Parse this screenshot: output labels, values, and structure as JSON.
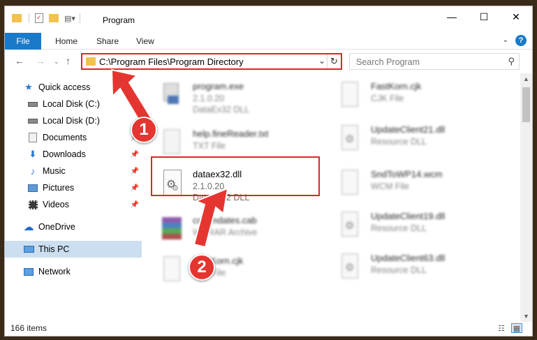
{
  "window": {
    "title": "Program",
    "controls": {
      "minimize": "—",
      "maximize": "☐",
      "close": "✕"
    }
  },
  "ribbon": {
    "file": "File",
    "tabs": [
      "Home",
      "Share",
      "View"
    ],
    "help": "?"
  },
  "nav": {
    "address": "C:\\Program Files\\Program Directory",
    "search_placeholder": "Search Program"
  },
  "sidebar": {
    "items": [
      {
        "label": "Quick access",
        "icon": "star-icon",
        "pinned": false
      },
      {
        "label": "Local Disk (C:)",
        "icon": "drive-icon",
        "pinned": false
      },
      {
        "label": "Local Disk (D:)",
        "icon": "drive-icon",
        "pinned": false
      },
      {
        "label": "Documents",
        "icon": "documents-icon",
        "pinned": true
      },
      {
        "label": "Downloads",
        "icon": "downloads-icon",
        "pinned": true
      },
      {
        "label": "Music",
        "icon": "music-icon",
        "pinned": true
      },
      {
        "label": "Pictures",
        "icon": "pictures-icon",
        "pinned": true
      },
      {
        "label": "Videos",
        "icon": "videos-icon",
        "pinned": true
      },
      {
        "label": "OneDrive",
        "icon": "cloud-icon",
        "pinned": false
      },
      {
        "label": "This PC",
        "icon": "pc-icon",
        "pinned": false,
        "selected": true
      },
      {
        "label": "Network",
        "icon": "network-icon",
        "pinned": false
      }
    ]
  },
  "files": {
    "left": [
      {
        "name": "program.exe",
        "meta1": "2.1.0.20",
        "meta2": "DataEx32 DLL",
        "icon": "exe-icon"
      },
      {
        "name": "help.fineReader.txt",
        "meta1": "TXT File",
        "meta2": "",
        "icon": "txt-file-icon"
      },
      {
        "name": "dataex32.dll",
        "meta1": "2.1.0.20",
        "meta2": "DataEx32 DLL",
        "icon": "dll-icon"
      },
      {
        "name": "commdates.cab",
        "meta1": "WinRAR Archive",
        "meta2": "",
        "icon": "archive-icon"
      },
      {
        "name": "FastKorn.cjk",
        "meta1": "CJK File",
        "meta2": "",
        "icon": "blank-file-icon"
      }
    ],
    "right": [
      {
        "name": "FastKorn.cjk",
        "meta1": "CJK File",
        "meta2": "",
        "icon": "blank-file-icon"
      },
      {
        "name": "UpdateClient21.dll",
        "meta1": "Resource DLL",
        "meta2": "",
        "icon": "dll-icon"
      },
      {
        "name": "SndToWP14.wcm",
        "meta1": "WCM File",
        "meta2": "",
        "icon": "blank-file-icon"
      },
      {
        "name": "UpdateClient19.dll",
        "meta1": "Resource DLL",
        "meta2": "",
        "icon": "dll-icon"
      },
      {
        "name": "UpdateClient63.dll",
        "meta1": "Resource DLL",
        "meta2": "",
        "icon": "dll-icon"
      }
    ]
  },
  "status": {
    "items": "166 items"
  },
  "annotations": {
    "step1": "1",
    "step2": "2",
    "color": "#e53530"
  }
}
